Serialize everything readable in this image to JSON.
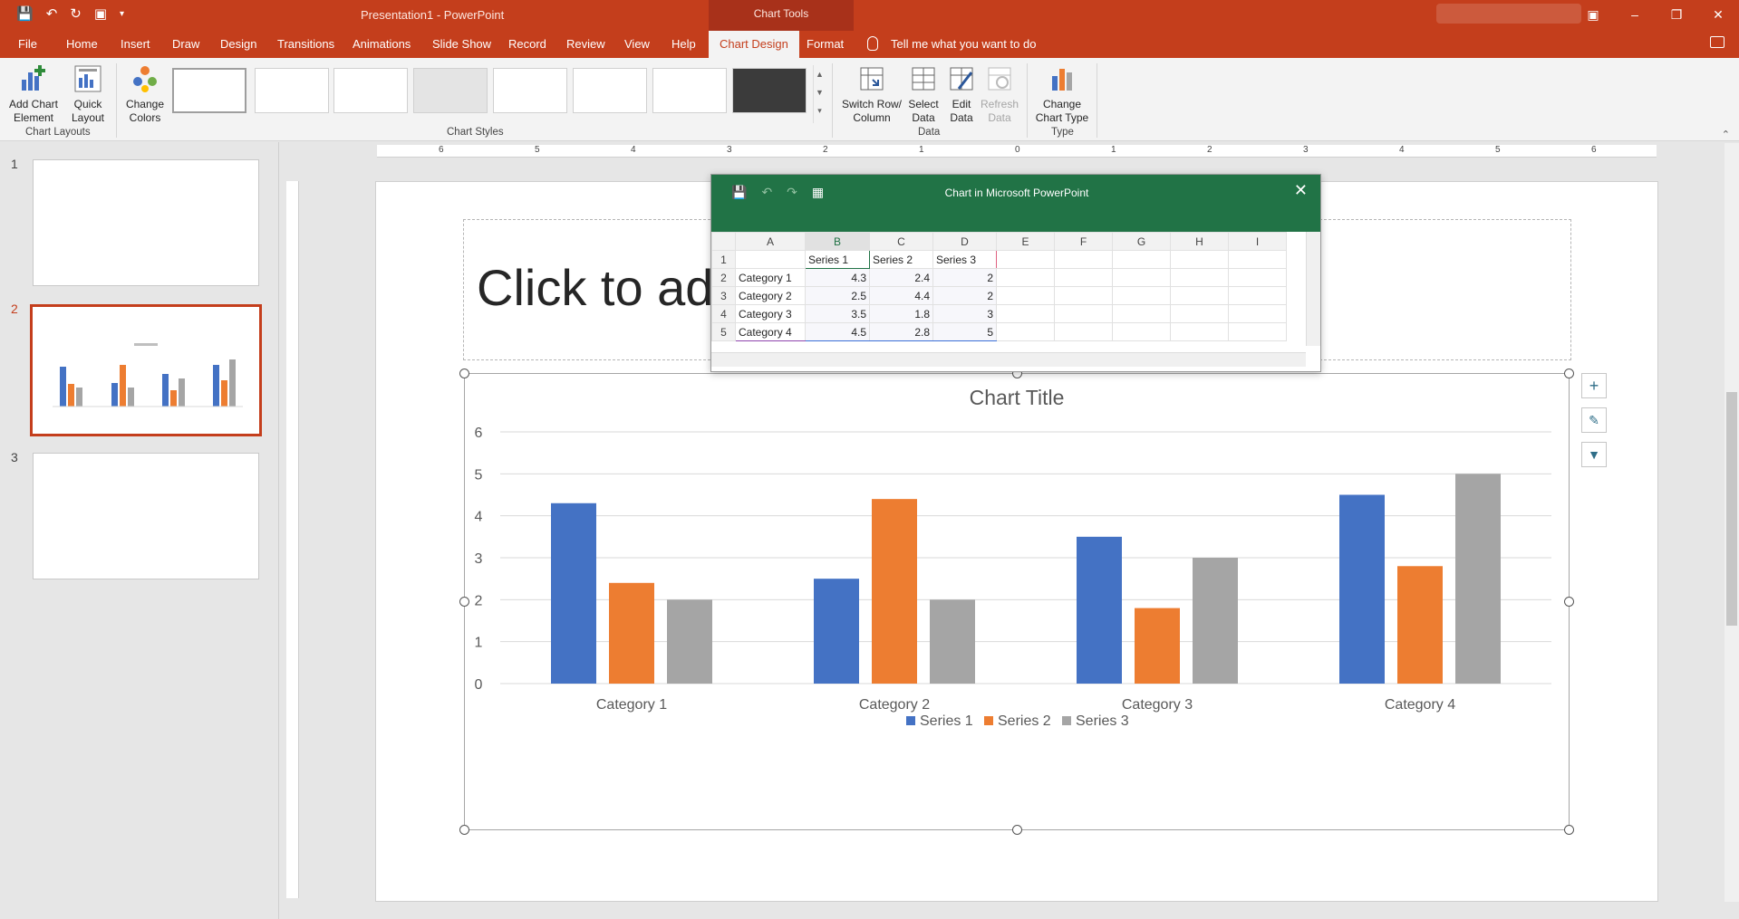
{
  "app": {
    "title": "Presentation1  -  PowerPoint",
    "context_group": "Chart Tools"
  },
  "tabs": [
    "File",
    "Home",
    "Insert",
    "Draw",
    "Design",
    "Transitions",
    "Animations",
    "Slide Show",
    "Record",
    "Review",
    "View",
    "Help",
    "Chart Design",
    "Format"
  ],
  "active_tab": "Chart Design",
  "tell_me": "Tell me what you want to do",
  "ribbon": {
    "add_chart_element": "Add Chart\nElement",
    "quick_layout": "Quick\nLayout",
    "change_colors": "Change\nColors",
    "chart_layouts_label": "Chart Layouts",
    "chart_styles_label": "Chart Styles",
    "switch_row_column": "Switch Row/\nColumn",
    "select_data": "Select\nData",
    "edit_data": "Edit\nData",
    "refresh_data": "Refresh\nData",
    "data_label": "Data",
    "change_chart_type": "Change\nChart Type",
    "type_label": "Type"
  },
  "slides": [
    {
      "number": "1"
    },
    {
      "number": "2",
      "active": true
    },
    {
      "number": "3"
    }
  ],
  "ruler_numbers": [
    "6",
    "5",
    "4",
    "3",
    "2",
    "1",
    "0",
    "1",
    "2",
    "3",
    "4",
    "5",
    "6"
  ],
  "title_placeholder": "Click to ad",
  "spreadsheet": {
    "window_title": "Chart in Microsoft PowerPoint",
    "columns": [
      "A",
      "B",
      "C",
      "D",
      "E",
      "F",
      "G",
      "H",
      "I"
    ],
    "rows": [
      {
        "row": "1",
        "cells": [
          "",
          "Series 1",
          "Series 2",
          "Series 3",
          "",
          "",
          "",
          "",
          ""
        ]
      },
      {
        "row": "2",
        "cells": [
          "Category 1",
          "4.3",
          "2.4",
          "2",
          "",
          "",
          "",
          "",
          ""
        ]
      },
      {
        "row": "3",
        "cells": [
          "Category 2",
          "2.5",
          "4.4",
          "2",
          "",
          "",
          "",
          "",
          ""
        ]
      },
      {
        "row": "4",
        "cells": [
          "Category 3",
          "3.5",
          "1.8",
          "3",
          "",
          "",
          "",
          "",
          ""
        ]
      },
      {
        "row": "5",
        "cells": [
          "Category 4",
          "4.5",
          "2.8",
          "5",
          "",
          "",
          "",
          "",
          ""
        ]
      }
    ]
  },
  "chart_data": {
    "type": "bar",
    "title": "Chart Title",
    "categories": [
      "Category 1",
      "Category 2",
      "Category 3",
      "Category 4"
    ],
    "series": [
      {
        "name": "Series 1",
        "values": [
          4.3,
          2.5,
          3.5,
          4.5
        ],
        "color": "#4472c4"
      },
      {
        "name": "Series 2",
        "values": [
          2.4,
          4.4,
          1.8,
          2.8
        ],
        "color": "#ed7d31"
      },
      {
        "name": "Series 3",
        "values": [
          2,
          2,
          3,
          5
        ],
        "color": "#a5a5a5"
      }
    ],
    "ylim": [
      0,
      6
    ],
    "yticks": [
      0,
      1,
      2,
      3,
      4,
      5,
      6
    ],
    "grid": true,
    "legend": "bottom"
  },
  "colors": {
    "accent": "#c43e1c",
    "excel_green": "#217346"
  }
}
